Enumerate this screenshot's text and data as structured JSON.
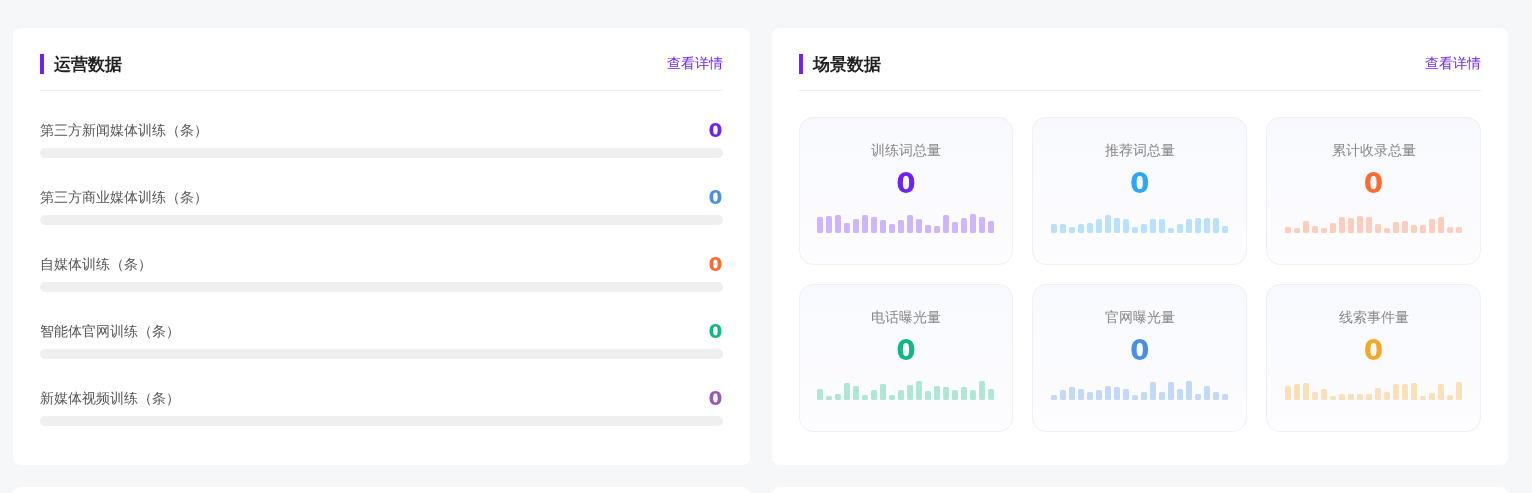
{
  "operations": {
    "title": "运营数据",
    "link": "查看详情",
    "items": [
      {
        "label": "第三方新闻媒体训练（条）",
        "value": "0",
        "color": "#7022f5",
        "level": 0
      },
      {
        "label": "第三方商业媒体训练（条）",
        "value": "0",
        "color": "#4a90e2",
        "level": 0
      },
      {
        "label": "自媒体训练（条）",
        "value": "0",
        "color": "#ff6a33",
        "level": 0
      },
      {
        "label": "智能体官网训练（条）",
        "value": "0",
        "color": "#10b981",
        "level": 0
      },
      {
        "label": "新媒体视频训练（条）",
        "value": "0",
        "color": "#9b59b6",
        "level": 0
      }
    ]
  },
  "scenes": {
    "title": "场景数据",
    "link": "查看详情",
    "tiles": [
      {
        "label": "训练词总量",
        "value": "0",
        "color": "#7022f5"
      },
      {
        "label": "推荐词总量",
        "value": "0",
        "color": "#2aa7ff"
      },
      {
        "label": "累计收录总量",
        "value": "0",
        "color": "#ff6a33"
      },
      {
        "label": "电话曝光量",
        "value": "0",
        "color": "#10b981"
      },
      {
        "label": "官网曝光量",
        "value": "0",
        "color": "#4a90e2"
      },
      {
        "label": "线索事件量",
        "value": "0",
        "color": "#f5a623"
      }
    ]
  }
}
